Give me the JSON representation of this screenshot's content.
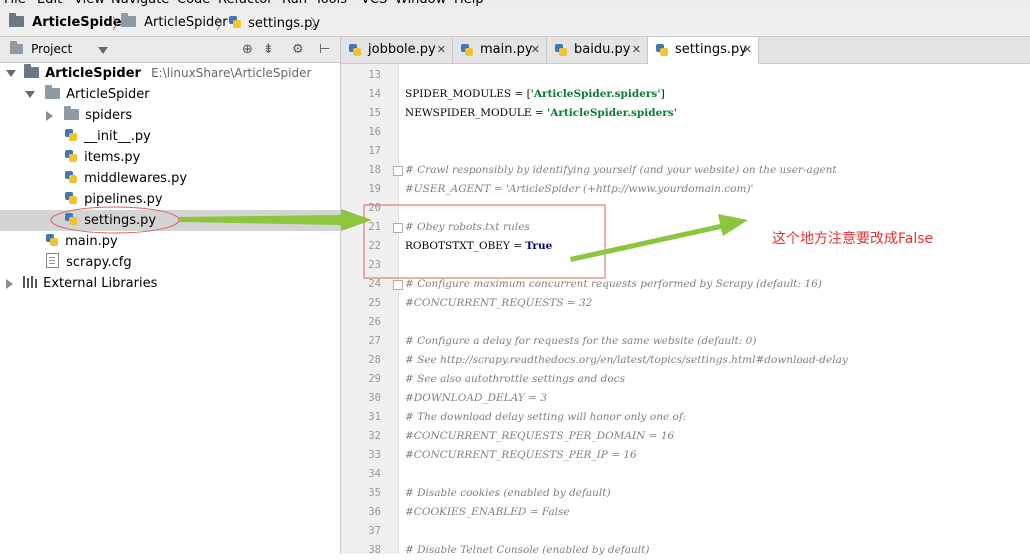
{
  "menu": [
    "File",
    "Edit",
    "View",
    "Navigate",
    "Code",
    "Refactor",
    "Run",
    "Tools",
    "VCS",
    "Window",
    "Help"
  ],
  "breadcrumb": [
    {
      "label": "ArticleSpider",
      "icon": "folder-icon"
    },
    {
      "label": "ArticleSpider",
      "icon": "folder-icon"
    },
    {
      "label": "settings.py",
      "icon": "python-file-icon"
    }
  ],
  "project_panel": {
    "title": "Project",
    "tree": [
      {
        "label": "ArticleSpider",
        "path": "E:\\linuxShare\\ArticleSpider",
        "icon": "folder-icon",
        "expanded": true
      },
      {
        "label": "ArticleSpider",
        "icon": "folder-icon",
        "expanded": true
      },
      {
        "label": "spiders",
        "icon": "folder-icon",
        "expanded": false
      },
      {
        "label": "__init__.py",
        "icon": "python-file-icon"
      },
      {
        "label": "items.py",
        "icon": "python-file-icon"
      },
      {
        "label": "middlewares.py",
        "icon": "python-file-icon"
      },
      {
        "label": "pipelines.py",
        "icon": "python-file-icon"
      },
      {
        "label": "settings.py",
        "icon": "python-file-icon",
        "selected": true
      },
      {
        "label": "main.py",
        "icon": "python-file-icon"
      },
      {
        "label": "scrapy.cfg",
        "icon": "file-icon"
      },
      {
        "label": "External Libraries",
        "icon": "library-icon",
        "expanded": false
      }
    ]
  },
  "tabs": [
    {
      "label": "jobbole.py",
      "active": false
    },
    {
      "label": "main.py",
      "active": false
    },
    {
      "label": "baidu.py",
      "active": false
    },
    {
      "label": "settings.py",
      "active": true
    }
  ],
  "editor": {
    "lines": [
      {
        "num": "13",
        "parts": []
      },
      {
        "num": "14",
        "parts": [
          {
            "t": "SPIDER_MODULES = [",
            "c": ""
          },
          {
            "t": "'ArticleSpider.spiders'",
            "c": "str"
          },
          {
            "t": "]",
            "c": ""
          }
        ]
      },
      {
        "num": "15",
        "parts": [
          {
            "t": "NEWSPIDER_MODULE = ",
            "c": ""
          },
          {
            "t": "'ArticleSpider.spiders'",
            "c": "str"
          }
        ]
      },
      {
        "num": "16",
        "parts": []
      },
      {
        "num": "17",
        "parts": []
      },
      {
        "num": "18",
        "parts": [
          {
            "t": "# Crawl responsibly by identifying yourself (and your website) on the user-agent",
            "c": "cm"
          }
        ]
      },
      {
        "num": "19",
        "parts": [
          {
            "t": "#USER_AGENT = 'ArticleSpider (+http://www.yourdomain.com)'",
            "c": "cm"
          }
        ]
      },
      {
        "num": "20",
        "parts": []
      },
      {
        "num": "21",
        "parts": [
          {
            "t": "# Obey robots.txt rules",
            "c": "cm"
          }
        ]
      },
      {
        "num": "22",
        "parts": [
          {
            "t": "ROBOTSTXT_OBEY = ",
            "c": ""
          },
          {
            "t": "True",
            "c": "kw"
          }
        ]
      },
      {
        "num": "23",
        "parts": []
      },
      {
        "num": "24",
        "parts": [
          {
            "t": "# Configure maximum concurrent requests performed by Scrapy (default: 16)",
            "c": "cm"
          }
        ]
      },
      {
        "num": "25",
        "parts": [
          {
            "t": "#CONCURRENT_REQUESTS = 32",
            "c": "cm"
          }
        ]
      },
      {
        "num": "26",
        "parts": []
      },
      {
        "num": "27",
        "parts": [
          {
            "t": "# Configure a delay for requests for the same website (default: 0)",
            "c": "cm"
          }
        ]
      },
      {
        "num": "28",
        "parts": [
          {
            "t": "# See http://scrapy.readthedocs.org/en/latest/topics/settings.html#download-delay",
            "c": "cm"
          }
        ]
      },
      {
        "num": "29",
        "parts": [
          {
            "t": "# See also autothrottle settings and docs",
            "c": "cm"
          }
        ]
      },
      {
        "num": "30",
        "parts": [
          {
            "t": "#DOWNLOAD_DELAY = 3",
            "c": "cm"
          }
        ]
      },
      {
        "num": "31",
        "parts": [
          {
            "t": "# The download delay setting will honor only one of:",
            "c": "cm"
          }
        ]
      },
      {
        "num": "32",
        "parts": [
          {
            "t": "#CONCURRENT_REQUESTS_PER_DOMAIN = 16",
            "c": "cm"
          }
        ]
      },
      {
        "num": "33",
        "parts": [
          {
            "t": "#CONCURRENT_REQUESTS_PER_IP = 16",
            "c": "cm"
          }
        ]
      },
      {
        "num": "34",
        "parts": []
      },
      {
        "num": "35",
        "parts": [
          {
            "t": "# Disable cookies (enabled by default)",
            "c": "cm"
          }
        ]
      },
      {
        "num": "36",
        "parts": [
          {
            "t": "#COOKIES_ENABLED = False",
            "c": "cm"
          }
        ]
      },
      {
        "num": "37",
        "parts": []
      },
      {
        "num": "38",
        "parts": [
          {
            "t": "# Disable Telnet Console (enabled by default)",
            "c": "cm"
          }
        ]
      }
    ]
  },
  "annotation": {
    "text": "这个地方注意要改成False",
    "color": "#e53333",
    "arrow_color": "#8cc63f",
    "box_color": "#e06060"
  }
}
